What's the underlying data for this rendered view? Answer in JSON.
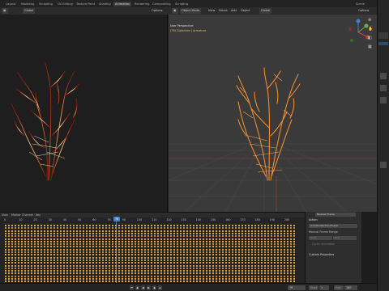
{
  "workspace_tabs": [
    "Layout",
    "Modeling",
    "Sculpting",
    "UV Editing",
    "Texture Paint",
    "Shading",
    "Animation",
    "Rendering",
    "Compositing",
    "Scripting"
  ],
  "active_tab": "Animation",
  "scene_label": "Scene",
  "left_header": {
    "orientation": "Global",
    "options": "Options"
  },
  "right_header": {
    "mode": "Object Mode",
    "view": "View",
    "select": "Select",
    "add": "Add",
    "object": "Object",
    "orientation": "Global",
    "options": "Options"
  },
  "viewport_info": {
    "line1": "User Perspective",
    "line2": "(76) Collection | Armature"
  },
  "timeline": {
    "menus": [
      "View",
      "Marker",
      "Channel",
      "Key"
    ],
    "ticks": [
      "0",
      "10",
      "20",
      "30",
      "40",
      "50",
      "60",
      "76",
      "90",
      "100",
      "110",
      "120",
      "130",
      "140",
      "150",
      "160",
      "170",
      "180",
      "190",
      "200"
    ],
    "current_frame": "76"
  },
  "action_panel": {
    "dropdown": "Nearest Frame",
    "section_action": "Action",
    "action_name": "ArmatureAction.Flower",
    "manual_frame_range": "Manual Frame Range",
    "start_label": "Start",
    "end_label": "End",
    "cyclic": "Cyclic Animation",
    "custom_props": "Custom Properties"
  },
  "playback": {
    "current": "76",
    "start_label": "Start",
    "start": "1",
    "end_label": "End",
    "end": "180"
  },
  "colors": {
    "accent": "#4a7ad4",
    "keyframe": "#e3a23a",
    "flower": "#f08a2e"
  }
}
